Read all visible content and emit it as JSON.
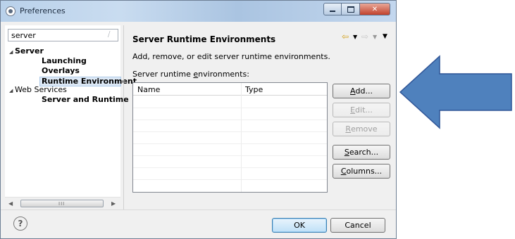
{
  "window": {
    "title": "Preferences",
    "controls": [
      "minimize",
      "maximize",
      "close"
    ]
  },
  "sidebar": {
    "filter_value": "server",
    "tree": [
      {
        "label": "Server",
        "expanded": true,
        "children": [
          "Launching",
          "Overlays",
          "Runtime Environment"
        ]
      },
      {
        "label": "Web Services",
        "expanded": true,
        "children": [
          "Server and Runtime"
        ]
      }
    ],
    "selected": "Runtime Environment",
    "scroll_grip": "III"
  },
  "page": {
    "title": "Server Runtime Environments",
    "description": "Add, remove, or edit server runtime environments.",
    "list_label_pre": "Server runtime ",
    "list_label_mn": "e",
    "list_label_post": "nvironments:",
    "table": {
      "columns": [
        "Name",
        "Type"
      ],
      "rows": []
    },
    "buttons": [
      {
        "pre": "",
        "mn": "A",
        "post": "dd...",
        "enabled": true
      },
      {
        "pre": "",
        "mn": "E",
        "post": "dit...",
        "enabled": false
      },
      {
        "pre": "",
        "mn": "R",
        "post": "emove",
        "enabled": false
      },
      {
        "pre": "",
        "mn": "S",
        "post": "earch...",
        "enabled": true
      },
      {
        "pre": "",
        "mn": "C",
        "post": "olumns...",
        "enabled": true
      }
    ]
  },
  "footer": {
    "help_symbol": "?",
    "ok_label": "OK",
    "cancel_label": "Cancel"
  },
  "annotation": {
    "arrow_color": "#4f81bd",
    "arrow_stroke": "#2f5597"
  },
  "colors": {
    "selection": "#dce8f5",
    "window_bg": "#f0f0f0"
  }
}
